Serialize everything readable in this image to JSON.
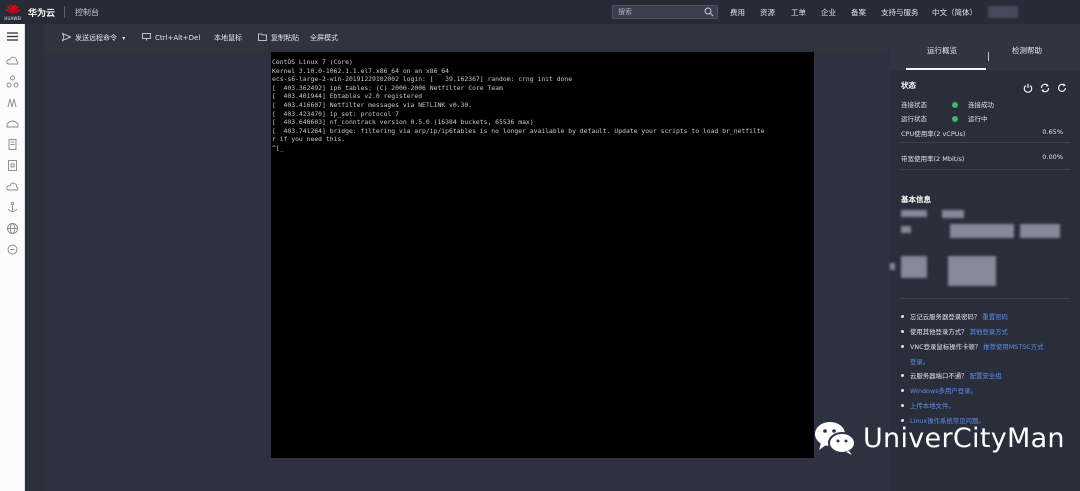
{
  "topbar": {
    "logo_text": "HUAWEI",
    "brand": "华为云",
    "console": "控制台",
    "search_placeholder": "搜索",
    "nav": [
      "费用",
      "资源",
      "工单",
      "企业",
      "备案",
      "支持与服务",
      "中文（简体）"
    ]
  },
  "toolbar": {
    "send_command": "发送远程命令",
    "ctrl_alt_del": "Ctrl+Alt+Del",
    "local_cursor": "本地鼠标",
    "copy_paste": "复制粘贴",
    "fullscreen": "全屏模式"
  },
  "terminal": {
    "lines": [
      "CentOS Linux 7 (Core)",
      "Kernel 3.10.0-1062.1.1.el7.x86_64 on an x86_64",
      "",
      "ecs-s6-large-2-win-20191229102002 login: [   39.162367] random: crng init done",
      "[  403.362492] ip6_tables: (C) 2000-2006 Netfilter Core Team",
      "[  403.401944] Ebtables v2.0 registered",
      "[  403.416607] Netfilter messages via NETLINK v0.30.",
      "[  403.423470] ip_set: protocol 7",
      "[  403.640603] nf_conntrack version 0.5.0 (16384 buckets, 65536 max)",
      "[  403.741264] bridge: filtering via arp/ip/ip6tables is no longer available by default. Update your scripts to load br_netfilte",
      "r if you need this.",
      "^[_"
    ]
  },
  "panel": {
    "tab_overview": "运行概览",
    "tab_help": "检测帮助",
    "status_title": "状态",
    "conn_label": "连接状态",
    "conn_value": "连接成功",
    "run_label": "运行状态",
    "run_value": "运行中",
    "cpu_label": "CPU使用率(2 vCPUs)",
    "cpu_value": "0.65%",
    "bw_label": "带宽使用率(2 Mbit/s)",
    "bw_value": "0.00%",
    "basic_title": "基本信息",
    "status_color": "#3cb371",
    "link_color": "#5b8def"
  },
  "faq": {
    "q1": "忘记云服务器登录密码？",
    "q1_link": "重置密码",
    "q2": "使用其他登录方式？",
    "q2_link": "其他登录方式",
    "q3": "VNC登录鼠标操作卡顿？",
    "q3_link": "推荐使用MSTSC方式",
    "q3_link2": "登录。",
    "q4": "云服务器端口不通？",
    "q4_link": "配置安全组",
    "l5": "Windows多用户登录。",
    "l6": "上传本地文件。",
    "l7": "Linux操作系统常见问题。"
  },
  "watermark": {
    "text": "UniverCityMan"
  }
}
